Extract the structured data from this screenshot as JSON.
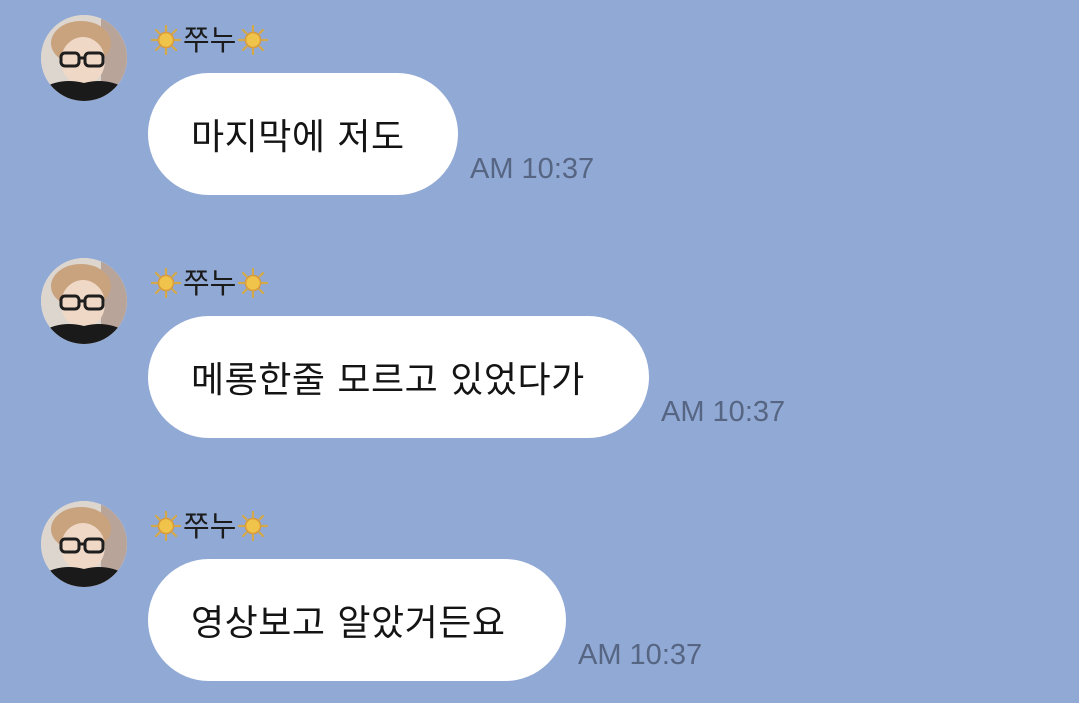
{
  "chat": {
    "background_color": "#91a9d5",
    "messages": [
      {
        "sender": {
          "name": "쭈누",
          "prefix_icon": "sun-icon",
          "suffix_icon": "sun-icon",
          "avatar": "profile-photo"
        },
        "text": "마지막에 저도",
        "time": "AM 10:37"
      },
      {
        "sender": {
          "name": "쭈누",
          "prefix_icon": "sun-icon",
          "suffix_icon": "sun-icon",
          "avatar": "profile-photo"
        },
        "text": "메롱한줄 모르고 있었다가",
        "time": "AM 10:37"
      },
      {
        "sender": {
          "name": "쭈누",
          "prefix_icon": "sun-icon",
          "suffix_icon": "sun-icon",
          "avatar": "profile-photo"
        },
        "text": "영상보고 알았거든요",
        "time": "AM 10:37"
      }
    ]
  }
}
